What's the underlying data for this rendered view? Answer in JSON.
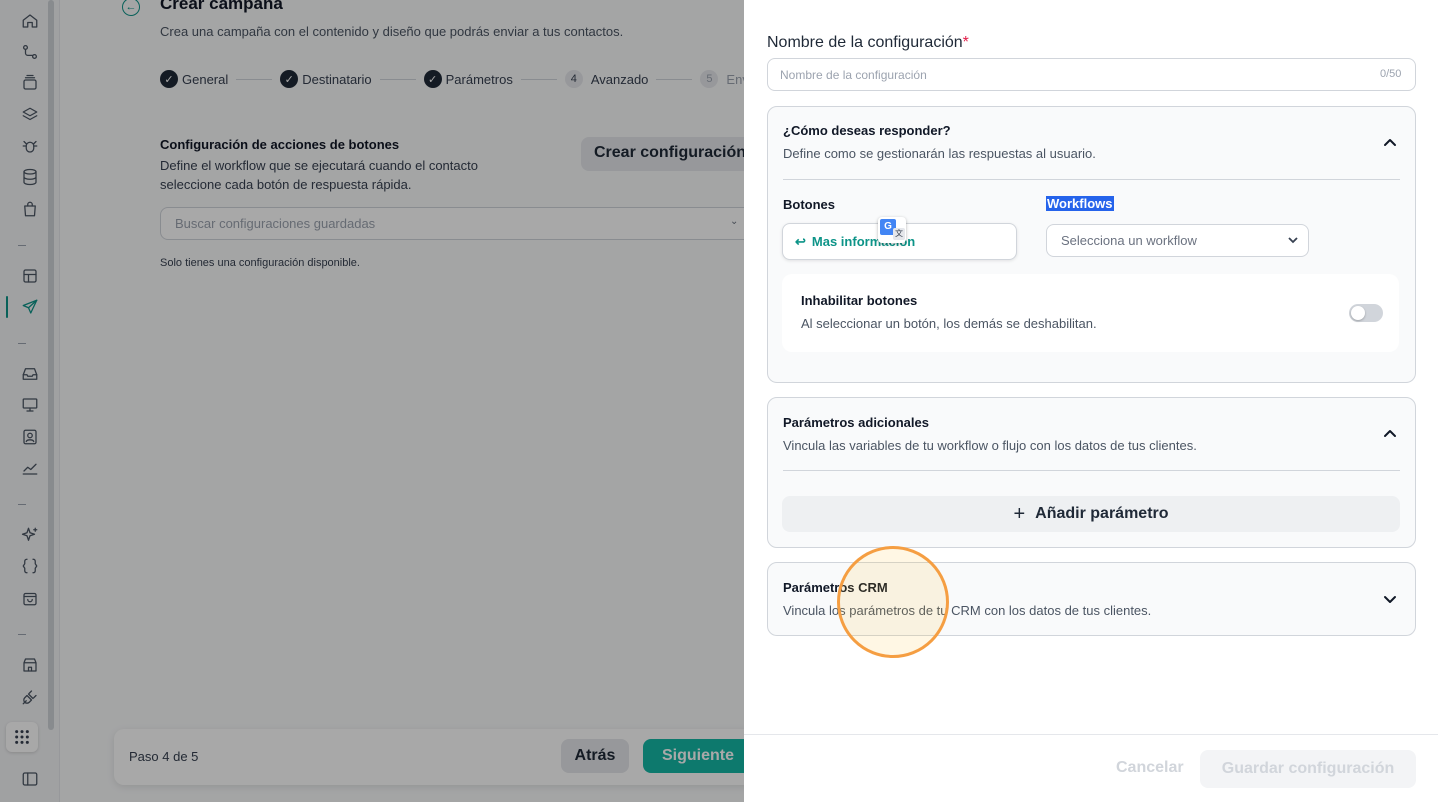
{
  "rail": {
    "icons": [
      "home-icon",
      "flow-icon",
      "inbox-box-icon",
      "layers-icon",
      "bug-icon",
      "database-icon",
      "bag-icon",
      "templates-icon",
      "send-icon",
      "inbox-icon",
      "monitor-icon",
      "contact-icon",
      "chart-icon",
      "sparkles-icon",
      "braces-icon",
      "shopping-bag-icon",
      "store-icon",
      "plug-icon",
      "apps-grid-icon",
      "sidebar-toggle-icon"
    ],
    "active": "send-icon",
    "accent": "#0d9488"
  },
  "main": {
    "title": "Crear campaña",
    "subtitle": "Crea una campaña con el contenido y diseño que podrás enviar a tus contactos.",
    "steps": [
      {
        "num": "",
        "label": "General",
        "done": true
      },
      {
        "num": "",
        "label": "Destinatario",
        "done": true
      },
      {
        "num": "",
        "label": "Parámetros",
        "done": true
      },
      {
        "num": "4",
        "label": "Avanzado",
        "done": false
      },
      {
        "num": "5",
        "label": "Env",
        "done": false
      }
    ],
    "config_title": "Configuración de acciones de botones",
    "config_desc": "Define el workflow que se ejecutará cuando el contacto seleccione cada botón de respuesta rápida.",
    "create_config_label": "Crear configuración",
    "search_placeholder": "Buscar configuraciones guardadas",
    "only_one_note": "Solo tienes una configuración disponible.",
    "step_counter": "Paso 4 de 5",
    "back_label": "Atrás",
    "next_label": "Siguiente"
  },
  "panel": {
    "name_label": "Nombre de la configuración",
    "required_mark": "*",
    "name_placeholder": "Nombre de la configuración",
    "name_value": "",
    "name_counter": "0/50",
    "respond": {
      "title": "¿Cómo deseas responder?",
      "desc": "Define como se gestionarán las respuestas al usuario.",
      "buttons_label": "Botones",
      "workflows_label": "Workflows",
      "button_item": "Mas información",
      "workflow_placeholder": "Selecciona un workflow",
      "disable_title": "Inhabilitar botones",
      "disable_desc": "Al seleccionar un botón, los demás se deshabilitan.",
      "disable_on": false
    },
    "extra_params": {
      "title": "Parámetros adicionales",
      "desc": "Vincula las variables de tu workflow o flujo con los datos de tus clientes.",
      "add_label": "Añadir parámetro"
    },
    "crm_params": {
      "title": "Parámetros CRM",
      "desc": "Vincula los parámetros de tu CRM con los datos de tus clientes."
    },
    "cancel_label": "Cancelar",
    "save_label": "Guardar configuración"
  },
  "colors": {
    "accent": "#0d9488",
    "next_button": "#14b8a6",
    "required": "#e11d48",
    "selection": "#2563eb",
    "cursor_ring": "#f59e42"
  }
}
